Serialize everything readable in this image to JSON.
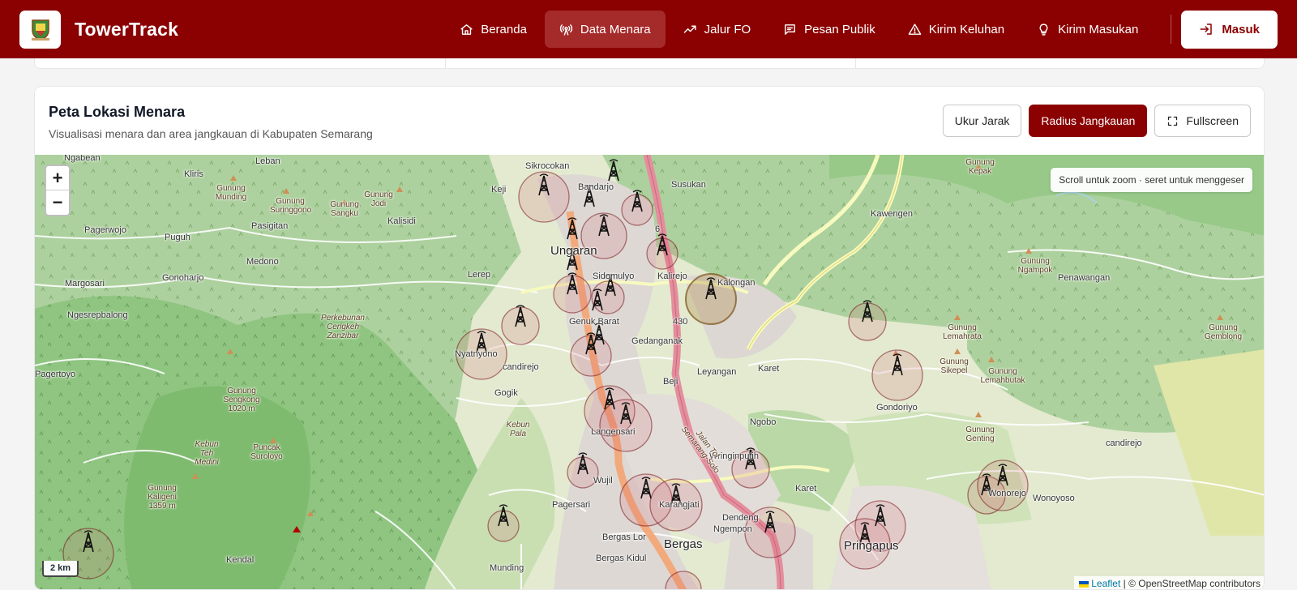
{
  "app": {
    "brand": "TowerTrack"
  },
  "nav": {
    "items": [
      {
        "label": "Beranda",
        "icon": "home-icon"
      },
      {
        "label": "Data Menara",
        "icon": "antenna-icon"
      },
      {
        "label": "Jalur FO",
        "icon": "trend-icon"
      },
      {
        "label": "Pesan Publik",
        "icon": "message-icon"
      },
      {
        "label": "Kirim Keluhan",
        "icon": "warning-icon"
      },
      {
        "label": "Kirim Masukan",
        "icon": "lightbulb-icon"
      }
    ],
    "active": "Data Menara",
    "login": "Masuk"
  },
  "map_card": {
    "title": "Peta Lokasi Menara",
    "subtitle": "Visualisasi menara dan area jangkauan di Kabupaten Semarang",
    "buttons": {
      "measure": "Ukur Jarak",
      "radius": "Radius Jangkauan",
      "fullscreen": "Fullscreen"
    }
  },
  "map": {
    "zoom_in": "+",
    "zoom_out": "−",
    "hint": "Scroll untuk zoom · seret untuk menggeser",
    "scale": "2 km",
    "attribution_link": "Leaflet",
    "attribution_rest": "| © OpenStreetMap contributors",
    "labels": {
      "ngabean": "Ngabean",
      "leban": "Leban",
      "kliris": "Kliris",
      "sikrocokan": "Sikrocokan",
      "keji": "Keji",
      "bandarjo": "Bandarjo",
      "susukan": "Susukan",
      "pagerwojo": "Pagerwojo",
      "puguh": "Puguh",
      "pasigitan": "Pasigitan",
      "kalisidi": "Kalisidi",
      "ungaran": "Ungaran",
      "kawengen": "Kawengen",
      "medono": "Medono",
      "lerep": "Lerep",
      "sidomulyo": "Sidomulyo",
      "kalirejo": "Kalirejo",
      "kalongan": "Kalongan",
      "margosari": "Margosari",
      "gonoharjo": "Gonoharjo",
      "penawangan": "Penawangan",
      "ngesrepbalong": "Ngesrepbalong",
      "genuk_barat": "Genuk Barat",
      "gedanganak": "Gedanganak",
      "nyatnyono": "Nyatnyono",
      "pagertoyo": "Pagertoyo",
      "candirejo": "candirejo",
      "leyangan": "Leyangan",
      "karet": "Karet",
      "beji": "Beji",
      "gogik": "Gogik",
      "gondoriyo": "Gondoriyo",
      "ngobo": "Ngobo",
      "langensari": "Langensari",
      "candirejo2": "candirejo",
      "wringinputih": "Wringinputih",
      "wujil": "Wujil",
      "karangjati": "Karangjati",
      "dendeng": "Dendeng",
      "karet2": "Karet",
      "wonorejo": "Wonorejo",
      "wonoyoso": "Wonoyoso",
      "pagersari": "Pagersari",
      "ngempon": "Ngempon",
      "bergas_lor": "Bergas Lor",
      "bergas": "Bergas",
      "pringapus": "Pringapus",
      "bergas_kidul": "Bergas Kidul",
      "munding": "Munding",
      "kendal": "Kendal",
      "road_430": "430",
      "road_6": "6"
    },
    "peaks": {
      "munding": "Gunung Munding",
      "suringgono": "Gunung Suringgono",
      "sangku": "Gunung Sangku",
      "jodi": "Gunung Jodi",
      "kepak": "Gunung Kepak",
      "ngampok": "Gunung Ngampok",
      "lemahrata": "Gunung Lemahrata",
      "sikepel": "Gunung Sikepel",
      "lemahbutak": "Gunung Lemahbutak",
      "gemblong": "Gunung Gemblong",
      "sengkong": "Gunung Sengkong 1020 m",
      "genting": "Gunung Genting",
      "suroloyo": "Puncak Suroloyo",
      "kaligeni": "Gunung Kaligeni 1359 m",
      "kebun_medini": "Kebun Teh Medini",
      "kebun_pala": "Kebun Pala",
      "perkebunan": "Perkebunan Cengkeh Zanzibar",
      "jalan_tol": "Jalan Tol Semarang-Solo"
    }
  }
}
